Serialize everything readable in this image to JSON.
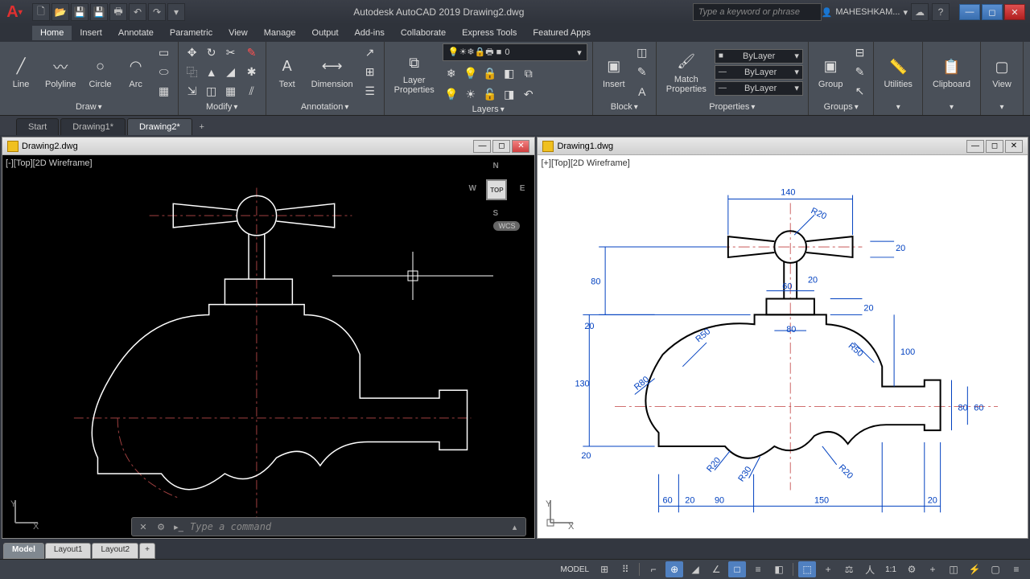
{
  "app": {
    "title": "Autodesk AutoCAD 2019   Drawing2.dwg",
    "searchPlaceholder": "Type a keyword or phrase",
    "user": "MAHESHKAM..."
  },
  "menu": {
    "tabs": [
      "Home",
      "Insert",
      "Annotate",
      "Parametric",
      "View",
      "Manage",
      "Output",
      "Add-ins",
      "Collaborate",
      "Express Tools",
      "Featured Apps"
    ],
    "active": "Home"
  },
  "ribbon": {
    "draw": {
      "label": "Draw",
      "line": "Line",
      "polyline": "Polyline",
      "circle": "Circle",
      "arc": "Arc"
    },
    "modify": {
      "label": "Modify"
    },
    "annotation": {
      "label": "Annotation",
      "text": "Text",
      "dimension": "Dimension"
    },
    "layers": {
      "label": "Layers",
      "props": "Layer\nProperties",
      "current": "0"
    },
    "block": {
      "label": "Block",
      "insert": "Insert"
    },
    "properties": {
      "label": "Properties",
      "match": "Match\nProperties",
      "color": "ByLayer",
      "ltype": "ByLayer",
      "lweight": "ByLayer"
    },
    "groups": {
      "label": "Groups",
      "group": "Group"
    },
    "utilities": {
      "label": "Utilities"
    },
    "clipboard": {
      "label": "Clipboard"
    },
    "view": {
      "label": "View"
    }
  },
  "docTabs": {
    "items": [
      "Start",
      "Drawing1*",
      "Drawing2*"
    ],
    "active": 2
  },
  "vp1": {
    "title": "Drawing2.dwg",
    "label": "[-][Top][2D Wireframe]",
    "viewcube": {
      "top": "TOP",
      "n": "N",
      "s": "S",
      "e": "E",
      "w": "W"
    },
    "wcs": "WCS"
  },
  "vp2": {
    "title": "Drawing1.dwg",
    "label": "[+][Top][2D Wireframe]"
  },
  "cmd": {
    "placeholder": "Type a command"
  },
  "bottomTabs": {
    "items": [
      "Model",
      "Layout1",
      "Layout2"
    ],
    "active": 0
  },
  "status": {
    "model": "MODEL",
    "scale": "1:1"
  },
  "dims": {
    "d140": "140",
    "R20": "R20",
    "d20a": "20",
    "d80a": "80",
    "d20b": "20",
    "d60": "60",
    "d20c": "20",
    "d20d": "20",
    "R50a": "R50",
    "d80b": "80",
    "R50b": "R50",
    "d100": "100",
    "d130": "130",
    "R80": "R80",
    "d60b": "60",
    "d80c": "80",
    "d20e": "20",
    "R20a": "R20",
    "R30": "R30",
    "R20b": "R20",
    "d60c": "60",
    "d20f": "20",
    "d90": "90",
    "d150": "150",
    "d20g": "20"
  }
}
